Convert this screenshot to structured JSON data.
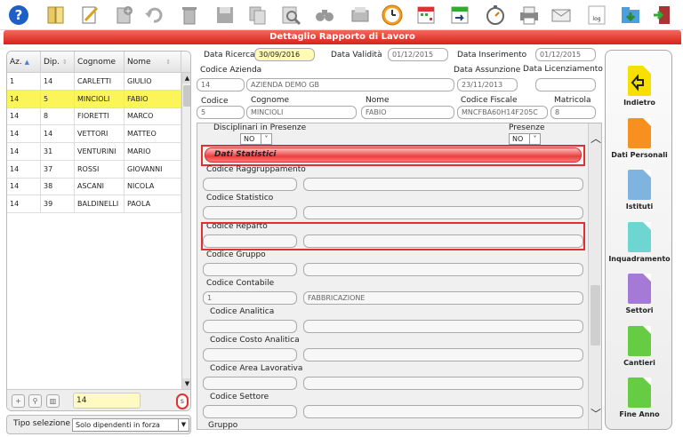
{
  "toolbar": {
    "icons": [
      "help-icon",
      "book-icon",
      "edit-icon",
      "new-document-icon",
      "undo-icon",
      "delete-icon",
      "save-icon",
      "copy-icon",
      "search-icon",
      "binoculars-icon",
      "print-preview-icon",
      "clock-icon",
      "calendar-icon",
      "calendar-arrow-icon",
      "stopwatch-icon",
      "printer-icon",
      "mail-icon",
      "log-icon",
      "download-folder-icon",
      "exit-icon"
    ],
    "log_label": "log"
  },
  "title": "Dettaglio Rapporto di Lavoro",
  "list": {
    "headers": [
      "Az.",
      "Dip.",
      "Cognome",
      "Nome"
    ],
    "rows": [
      {
        "az": "1",
        "dip": "14",
        "cognome": "CARLETTI",
        "nome": "GIULIO",
        "selected": false
      },
      {
        "az": "14",
        "dip": "5",
        "cognome": "MINCIOLI",
        "nome": "FABIO",
        "selected": true
      },
      {
        "az": "14",
        "dip": "8",
        "cognome": "FIORETTI",
        "nome": "MARCO",
        "selected": false
      },
      {
        "az": "14",
        "dip": "14",
        "cognome": "VETTORI",
        "nome": "MATTEO",
        "selected": false
      },
      {
        "az": "14",
        "dip": "31",
        "cognome": "VENTURINI",
        "nome": "MARIO",
        "selected": false
      },
      {
        "az": "14",
        "dip": "37",
        "cognome": "ROSSI",
        "nome": "GIOVANNI",
        "selected": false
      },
      {
        "az": "14",
        "dip": "38",
        "cognome": "ASCANI",
        "nome": "NICOLA",
        "selected": false
      },
      {
        "az": "14",
        "dip": "39",
        "cognome": "BALDINELLI",
        "nome": "PAOLA",
        "selected": false
      }
    ],
    "filter_value": "14",
    "s_label": "s",
    "tipo_label": "Tipo selezione",
    "tipo_value": "Solo dipendenti in forza"
  },
  "header": {
    "data_ricerca_label": "Data Ricerca",
    "data_ricerca": "30/09/2016",
    "data_validita_label": "Data Validità",
    "data_validita": "01/12/2015",
    "data_inserimento_label": "Data Inserimento",
    "data_inserimento": "01/12/2015",
    "codice_azienda_label": "Codice Azienda",
    "codice_azienda": "14",
    "azienda_nome": "AZIENDA DEMO GB",
    "data_assunzione_label": "Data Assunzione",
    "data_assunzione": "23/11/2013",
    "data_licenziamento_label": "Data Licenziamento",
    "data_licenziamento": "",
    "codice_label": "Codice",
    "codice": "5",
    "cognome_label": "Cognome",
    "cognome": "MINCIOLI",
    "nome_label": "Nome",
    "nome": "FABIO",
    "codice_fiscale_label": "Codice Fiscale",
    "codice_fiscale": "MNCFBA60H14F205C",
    "matricola_label": "Matricola",
    "matricola": "8"
  },
  "detail": {
    "disciplinari_label": "Disciplinari in Presenze",
    "disciplinari_value": "NO",
    "presenze_label": "Presenze",
    "presenze_value": "NO",
    "section_title": "Dati Statistici",
    "fields": [
      {
        "label": "Codice Raggruppamento",
        "code": "",
        "desc": ""
      },
      {
        "label": "Codice Statistico",
        "code": "",
        "desc": ""
      },
      {
        "label": "Codice Reparto",
        "code": "",
        "desc": ""
      },
      {
        "label": "Codice Gruppo",
        "code": "",
        "desc": ""
      },
      {
        "label": "Codice Contabile",
        "code": "1",
        "desc": "FABBRICAZIONE"
      },
      {
        "label": "Codice Analitica",
        "code": "",
        "desc": ""
      },
      {
        "label": "Codice Costo Analitica",
        "code": "",
        "desc": ""
      },
      {
        "label": "Codice Area Lavorativa",
        "code": "",
        "desc": ""
      },
      {
        "label": "Codice Settore",
        "code": "",
        "desc": ""
      },
      {
        "label": "Gruppo",
        "code": "",
        "desc": ""
      }
    ]
  },
  "nav": [
    {
      "label": "Indietro",
      "color": "#f7e000"
    },
    {
      "label": "Dati Personali",
      "color": "#f7901e"
    },
    {
      "label": "Istituti",
      "color": "#7fb3e0"
    },
    {
      "label": "Inquadramento",
      "color": "#6ed6d0"
    },
    {
      "label": "Settori",
      "color": "#a57ad6"
    },
    {
      "label": "Cantieri",
      "color": "#66cc44"
    },
    {
      "label": "Fine Anno",
      "color": "#66cc44"
    }
  ]
}
